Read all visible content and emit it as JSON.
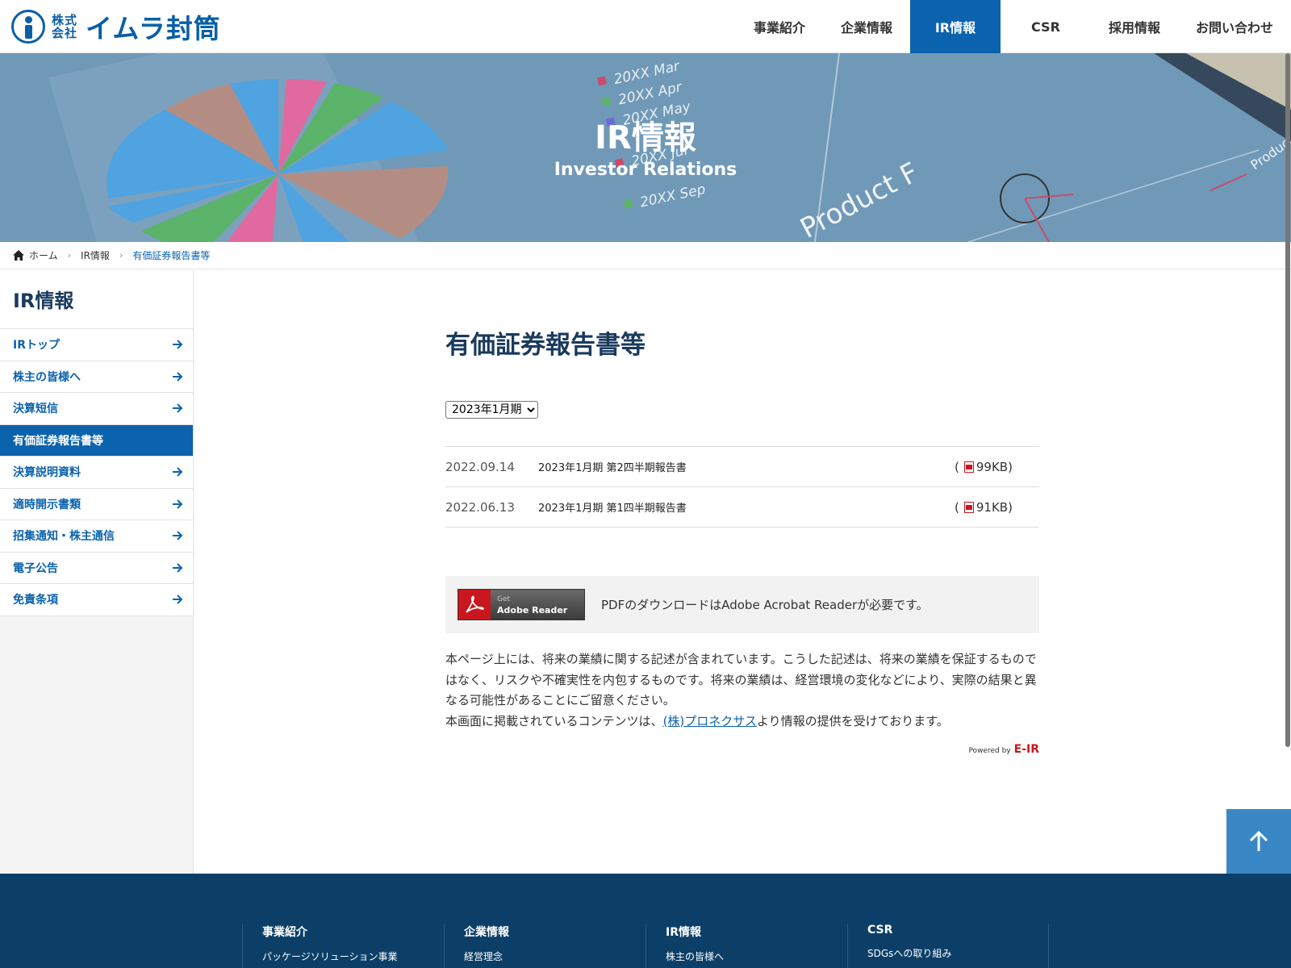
{
  "header": {
    "logo_small": "株式会社",
    "logo_name": "イムラ封筒",
    "nav": [
      {
        "label": "事業紹介",
        "active": false
      },
      {
        "label": "企業情報",
        "active": false
      },
      {
        "label": "IR情報",
        "active": true
      },
      {
        "label": "CSR",
        "active": false
      },
      {
        "label": "採用情報",
        "active": false
      },
      {
        "label": "お問い合わせ",
        "active": false
      }
    ]
  },
  "hero": {
    "title": "IR情報",
    "subtitle": "Investor Relations",
    "bg_text": [
      "20XX Mar",
      "20XX Apr",
      "20XX May",
      "20XX Jul",
      "20XX Sep",
      "Product F",
      "Product"
    ]
  },
  "breadcrumb": {
    "home": "ホーム",
    "items": [
      "IR情報",
      "有価証券報告書等"
    ]
  },
  "sidebar": {
    "title": "IR情報",
    "items": [
      {
        "label": "IRトップ",
        "active": false
      },
      {
        "label": "株主の皆様へ",
        "active": false
      },
      {
        "label": "決算短信",
        "active": false
      },
      {
        "label": "有価証券報告書等",
        "active": true
      },
      {
        "label": "決算説明資料",
        "active": false
      },
      {
        "label": "適時開示書類",
        "active": false
      },
      {
        "label": "招集通知・株主通信",
        "active": false
      },
      {
        "label": "電子公告",
        "active": false
      },
      {
        "label": "免責条項",
        "active": false
      }
    ]
  },
  "main": {
    "title": "有価証券報告書等",
    "period_select": "2023年1月期",
    "documents": [
      {
        "date": "2022.09.14",
        "title": "2023年1月期 第2四半期報告書",
        "size_open": "(",
        "size": "99KB)"
      },
      {
        "date": "2022.06.13",
        "title": "2023年1月期 第1四半期報告書",
        "size_open": "(",
        "size": "91KB)"
      }
    ],
    "adobe": {
      "badge_get": "Get",
      "badge_name": "Adobe Reader",
      "message": "PDFのダウンロードはAdobe Acrobat Readerが必要です。"
    },
    "notice_1": "本ページ上には、将来の業績に関する記述が含まれています。こうした記述は、将来の業績を保証するものではなく、リスクや不確実性を内包するものです。将来の業績は、経営環境の変化などにより、実際の結果と異なる可能性があることにご留意ください。",
    "notice_2_before": "本画面に掲載されているコンテンツは、",
    "notice_2_link": "(株)プロネクサス",
    "notice_2_after": "より情報の提供を受けております。",
    "powered_by": "Powered by",
    "powered_brand": "E-IR"
  },
  "footer": {
    "columns": [
      {
        "heading": "事業紹介",
        "link": "パッケージソリューション事業"
      },
      {
        "heading": "企業情報",
        "link": "経営理念"
      },
      {
        "heading": "IR情報",
        "link": "株主の皆様へ"
      },
      {
        "heading": "CSR",
        "link": "SDGsへの取り組み"
      }
    ]
  },
  "colors": {
    "brand_blue": "#0b63ad",
    "footer_navy": "#0c3f67",
    "title_navy": "#1a3a5e"
  }
}
